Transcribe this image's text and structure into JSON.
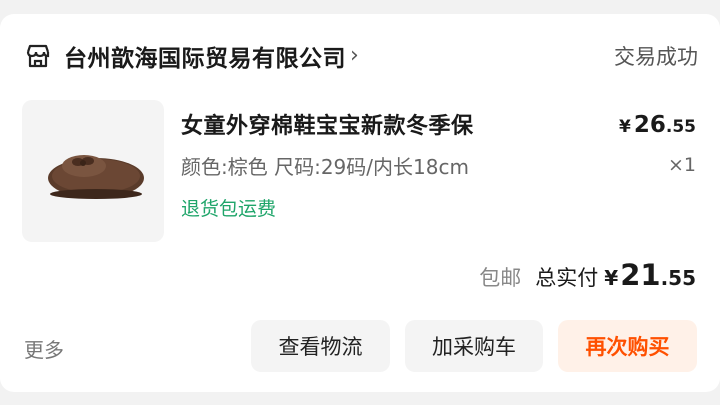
{
  "order": {
    "shop": {
      "icon": "store-icon",
      "name": "台州歆海国际贸易有限公司",
      "chevron": "›"
    },
    "status": "交易成功",
    "item": {
      "image_icon": "brown-fluffy-shoe-image",
      "title": "女童外穿棉鞋宝宝新款冬季保",
      "spec": "颜色:棕色 尺码:29码/内长18cm",
      "return_note": "退货包运费",
      "price": {
        "symbol": "¥",
        "integer": "26",
        "decimal": ".55"
      },
      "quantity": "×1"
    },
    "summary": {
      "shipping": "包邮",
      "total_label": "总实付",
      "total": {
        "symbol": "¥",
        "integer": "21",
        "decimal": ".55"
      }
    },
    "actions": {
      "more": "更多",
      "logistics": "查看物流",
      "add_to_cart": "加采购车",
      "buy_again": "再次购买"
    }
  },
  "colors": {
    "return_green": "#1fa56a",
    "buy_again_orange": "#ff5000",
    "buy_again_bg": "#fff1e8"
  }
}
